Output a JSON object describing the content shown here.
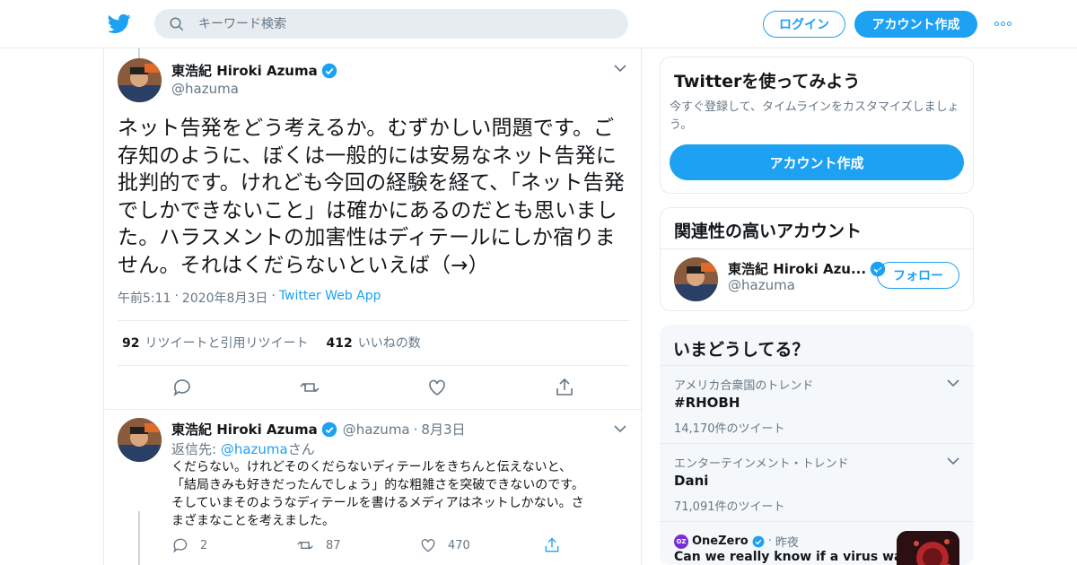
{
  "header": {
    "search_placeholder": "キーワード検索",
    "login_label": "ログイン",
    "signup_label": "アカウント作成"
  },
  "main_tweet": {
    "author_name": "東浩紀 Hiroki Azuma",
    "handle": "@hazuma",
    "text": "ネット告発をどう考えるか。むずかしい問題です。ご存知のように、ぼくは一般的には安易なネット告発に批判的です。けれども今回の経験を経て、「ネット告発でしかできないこと」は確かにあるのだとも思いました。ハラスメントの加害性はディテールにしか宿りません。それはくだらないといえば（→）",
    "time": "午前5:11",
    "date": "2020年8月3日",
    "via": "Twitter Web App",
    "retweets_count": "92",
    "retweets_label": "リツイートと引用リツイート",
    "likes_count": "412",
    "likes_label": "いいねの数"
  },
  "reply_tweet": {
    "author_name": "東浩紀 Hiroki Azuma",
    "handle": "@hazuma",
    "date": "8月3日",
    "reply_prefix": "返信先: ",
    "reply_handle": "@hazuma",
    "reply_suffix": "さん",
    "text_lines": [
      "くだらない。けれどそのくだらないディテールをきちんと伝えないと、",
      "「結局きみも好きだったんでしょう」的な粗雑さを突破できないのです。",
      "そしていまそのようなディテールを書けるメディアはネットしかない。さ",
      "まざまなことを考えました。"
    ],
    "replies": "2",
    "retweets": "87",
    "likes": "470"
  },
  "sidebar": {
    "try_title": "Twitterを使ってみよう",
    "try_desc_1": "今すぐ登録して、タイムラインをカスタマイズしましょ",
    "try_desc_2": "う。",
    "try_button": "アカウント作成",
    "related_title": "関連性の高いアカウント",
    "related_name": "東浩紀 Hiroki Azu...",
    "related_handle": "@hazuma",
    "follow_label": "フォロー",
    "trends_title": "いまどうしてる？",
    "trends": [
      {
        "category": "アメリカ合衆国のトレンド",
        "name": "#RHOBH",
        "count": "14,170件のツイート"
      },
      {
        "category": "エンターテインメント・トレンド",
        "name": "Dani",
        "count": "71,091件のツイート"
      }
    ],
    "news": {
      "source": "OneZero",
      "time": "昨夜",
      "headline": "Can we really know if a virus was"
    }
  },
  "colors": {
    "accent": "#1da1f2",
    "text": "#14171a",
    "muted": "#657786",
    "border": "#e6ecf0"
  }
}
